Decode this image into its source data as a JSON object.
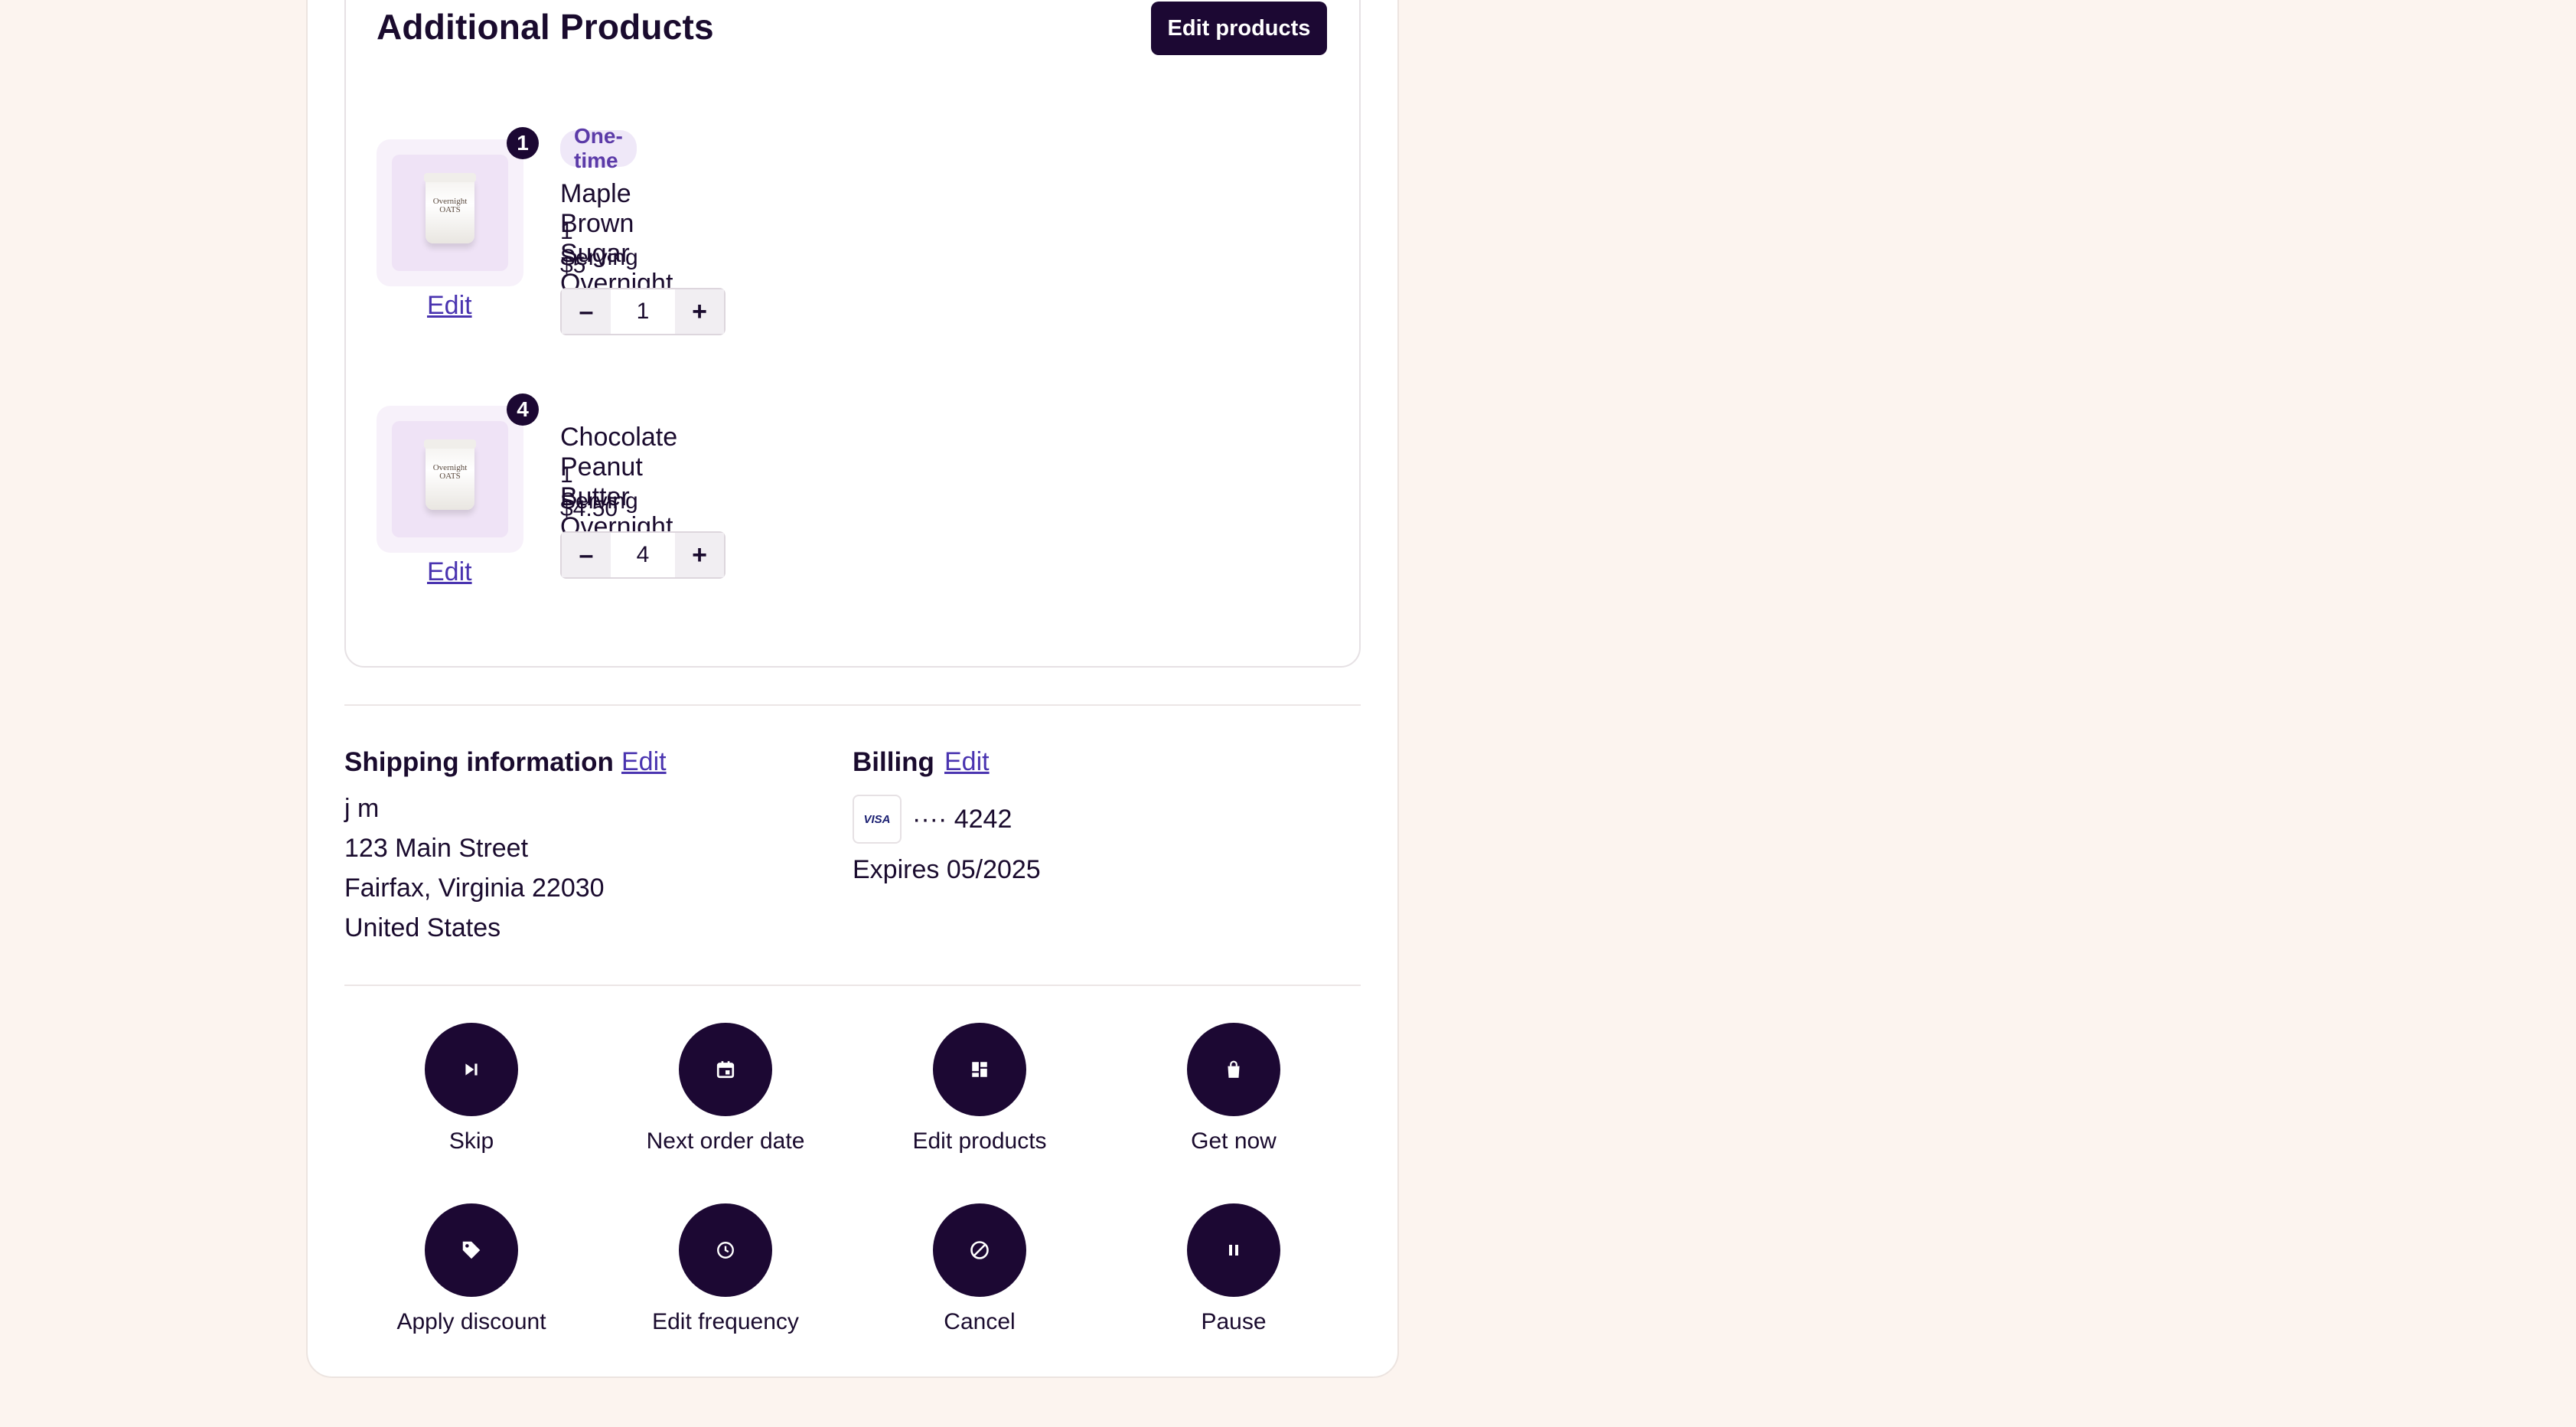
{
  "additional_products": {
    "title": "Additional Products",
    "edit_button": "Edit products",
    "items": [
      {
        "badge": "1",
        "jar_label": "Overnight OATS",
        "tag": "One-time",
        "name": "Maple Brown Sugar Overnight Oats",
        "serving": "1 Serving",
        "price": "$5",
        "quantity": "1",
        "edit_link": "Edit"
      },
      {
        "badge": "4",
        "jar_label": "Overnight OATS",
        "tag": "",
        "name": "Chocolate Peanut Butter Overnight Oats",
        "serving": "1 Serving",
        "price": "$4.50",
        "quantity": "4",
        "edit_link": "Edit"
      }
    ],
    "minus_symbol": "–",
    "plus_symbol": "+"
  },
  "shipping": {
    "heading": "Shipping information",
    "edit_link": "Edit",
    "name": "j m",
    "street": "123 Main Street",
    "city_state_zip": "Fairfax, Virginia 22030",
    "country": "United States"
  },
  "billing": {
    "heading": "Billing",
    "edit_link": "Edit",
    "card_brand": "VISA",
    "card_masked": "···· 4242",
    "expires": "Expires 05/2025"
  },
  "actions": [
    {
      "label": "Skip",
      "icon": "skip-icon"
    },
    {
      "label": "Next order date",
      "icon": "calendar-icon"
    },
    {
      "label": "Edit products",
      "icon": "grid-icon"
    },
    {
      "label": "Get now",
      "icon": "shopping-bag-icon"
    },
    {
      "label": "Apply discount",
      "icon": "tag-icon"
    },
    {
      "label": "Edit frequency",
      "icon": "clock-icon"
    },
    {
      "label": "Cancel",
      "icon": "cancel-icon"
    },
    {
      "label": "Pause",
      "icon": "pause-icon"
    }
  ],
  "colors": {
    "background": "#fcf4ef",
    "primary": "#1c0833",
    "link": "#4a34b0",
    "tag_bg": "#efe8f8"
  }
}
